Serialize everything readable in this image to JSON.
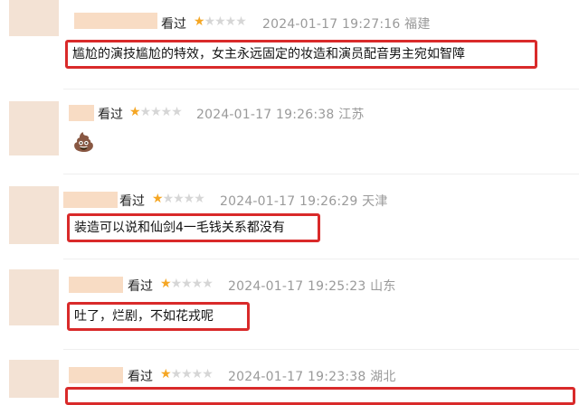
{
  "comments": [
    {
      "watched": "看过",
      "stars": "★",
      "stars_off": "★★★★",
      "meta": "2024-01-17 19:27:16 福建",
      "text": "尴尬的演技尴尬的特效，女主永远固定的妆造和演员配音男主宛如智障"
    },
    {
      "watched": "看过",
      "stars": "★",
      "stars_off": "★★★★",
      "meta": "2024-01-17 19:26:38 江苏",
      "text": "💩"
    },
    {
      "watched": "看过",
      "stars": "★",
      "stars_off": "★★★★",
      "meta": "2024-01-17 19:26:29 天津",
      "text": "装造可以说和仙剑4一毛钱关系都没有"
    },
    {
      "watched": "看过",
      "stars": "★",
      "stars_off": "★★★★",
      "meta": "2024-01-17 19:25:23 山东",
      "text": "吐了，烂剧，不如花戎呢"
    },
    {
      "watched": "看过",
      "stars": "★",
      "stars_off": "★★★★",
      "meta": "2024-01-17 19:23:38 湖北",
      "text": ""
    }
  ],
  "rating_value": 1,
  "rating_max": 5,
  "colors": {
    "highlight_border": "#d92a2a",
    "star_on": "#f5a623",
    "star_off": "#d6d6d6",
    "meta": "#9a9a9a"
  }
}
